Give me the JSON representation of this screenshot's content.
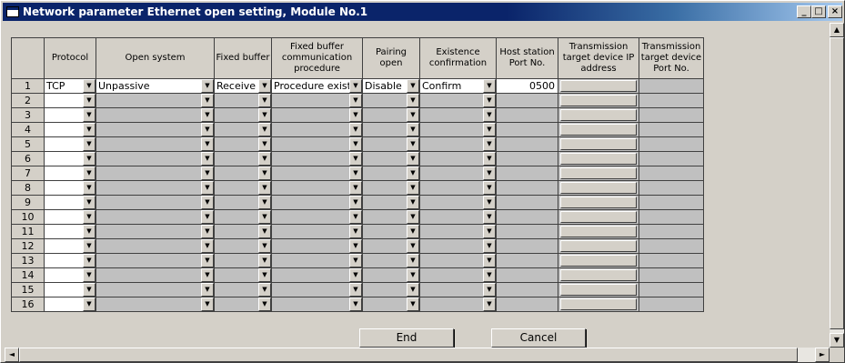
{
  "window": {
    "title": "Network parameter Ethernet open setting, Module No.1"
  },
  "titlebar_buttons": {
    "minimize": "_",
    "maximize": "□",
    "close": "×"
  },
  "columns": [
    "Protocol",
    "Open system",
    "Fixed buffer",
    "Fixed buffer communication procedure",
    "Pairing open",
    "Existence confirmation",
    "Host station Port No.",
    "Transmission target device IP address",
    "Transmission target device Port No."
  ],
  "rows": [
    {
      "num": "1",
      "protocol": "TCP",
      "open_system": "Unpassive",
      "fixed_buffer": "Receive",
      "procedure": "Procedure exist",
      "pairing": "Disable",
      "existence": "Confirm",
      "host_port": "0500"
    },
    {
      "num": "2"
    },
    {
      "num": "3"
    },
    {
      "num": "4"
    },
    {
      "num": "5"
    },
    {
      "num": "6"
    },
    {
      "num": "7"
    },
    {
      "num": "8"
    },
    {
      "num": "9"
    },
    {
      "num": "10"
    },
    {
      "num": "11"
    },
    {
      "num": "12"
    },
    {
      "num": "13"
    },
    {
      "num": "14"
    },
    {
      "num": "15"
    },
    {
      "num": "16"
    }
  ],
  "buttons": {
    "end": "End",
    "cancel": "Cancel"
  },
  "icons": {
    "dropdown": "▼",
    "scroll_up": "▲",
    "scroll_down": "▼",
    "scroll_left": "◄",
    "scroll_right": "►"
  }
}
